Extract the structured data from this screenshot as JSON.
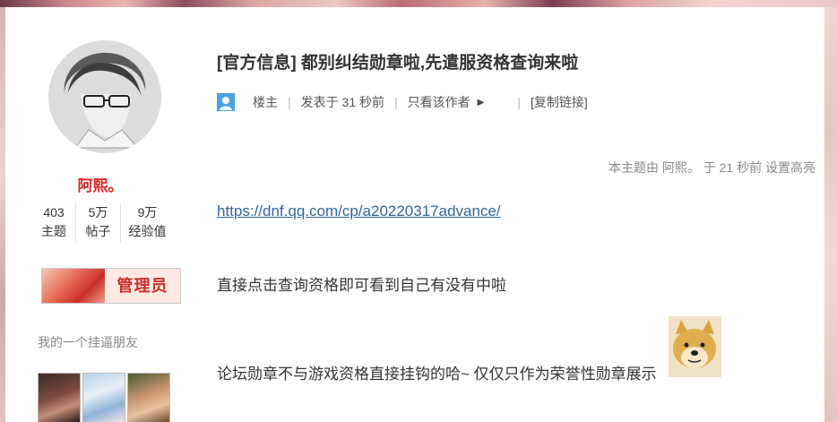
{
  "sidebar": {
    "username": "阿熙。",
    "stats": [
      {
        "value": "403",
        "label": "主题"
      },
      {
        "value": "5万",
        "label": "帖子"
      },
      {
        "value": "9万",
        "label": "经验值"
      }
    ],
    "badge_label": "管理员",
    "friends_title": "我的一个挂逼朋友"
  },
  "post": {
    "title": "[官方信息] 都别纠结勋章啦,先遣服资格查询来啦",
    "meta": {
      "floor": "楼主",
      "posted": "发表于 31 秒前",
      "only_author": "只看该作者",
      "copy_link": "[复制链接]"
    },
    "highlight_note": "本主题由 阿熙。 于 21 秒前 设置高亮",
    "link": "https://dnf.qq.com/cp/a20220317advance/",
    "paragraphs": [
      "直接点击查询资格即可看到自己有没有中啦",
      "论坛勋章不与游戏资格直接挂钩的哈~ 仅仅只作为荣誉性勋章展示"
    ]
  },
  "colors": {
    "username": "#d9282a",
    "link": "#336699",
    "user_icon": "#4aa3df"
  }
}
